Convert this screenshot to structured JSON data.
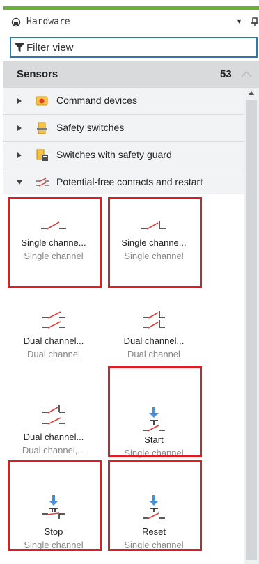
{
  "window": {
    "title": "Hardware",
    "dropdown_glyph": "▾"
  },
  "filter": {
    "text": "Filter view"
  },
  "section": {
    "title": "Sensors",
    "count": "53"
  },
  "categories": [
    {
      "label": "Command devices",
      "icon": "command-device-icon",
      "expanded": false
    },
    {
      "label": "Safety switches",
      "icon": "safety-switch-icon",
      "expanded": false
    },
    {
      "label": "Switches with safety guard",
      "icon": "guard-switch-icon",
      "expanded": false
    },
    {
      "label": "Potential-free contacts and restart",
      "icon": "potential-free-contact-icon",
      "expanded": true
    }
  ],
  "items": [
    {
      "name": "Single channe...",
      "sub": "Single channel",
      "symbol": "single-nc-contact-icon",
      "highlighted": true
    },
    {
      "name": "Single channe...",
      "sub": "Single channel",
      "symbol": "single-no-contact-icon",
      "highlighted": true
    },
    {
      "name": "Dual channel...",
      "sub": "Dual channel",
      "symbol": "dual-nc-contact-icon",
      "highlighted": false
    },
    {
      "name": "Dual channel...",
      "sub": "Dual channel",
      "symbol": "dual-no-contact-icon",
      "highlighted": false
    },
    {
      "name": "Dual channel...",
      "sub": "Dual channel,...",
      "symbol": "dual-mixed-contact-icon",
      "highlighted": false
    },
    {
      "name": "Start",
      "sub": "Single channel",
      "symbol": "start-button-icon",
      "highlighted": true
    },
    {
      "name": "Stop",
      "sub": "Single channel",
      "symbol": "stop-button-icon",
      "highlighted": true
    },
    {
      "name": "Reset",
      "sub": "Single channel",
      "symbol": "reset-button-icon",
      "highlighted": true
    }
  ],
  "colors": {
    "accent_green": "#65b32e",
    "filter_border": "#2f78a8",
    "highlight_red": "#e01b22",
    "contact_red": "#d9413d",
    "arrow_blue": "#4a90d9"
  }
}
